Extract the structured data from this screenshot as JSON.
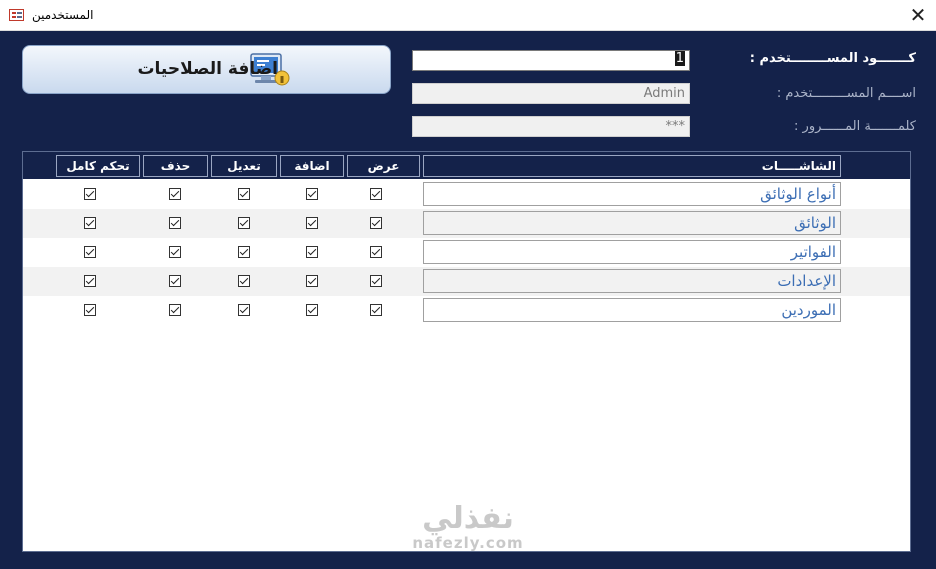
{
  "window": {
    "title": "المستخدمين",
    "close_glyph": "✕"
  },
  "form": {
    "permissions_button": "اضافة الصلاحيات",
    "user_code": {
      "label": "كـــــــود المســــــــتخدم :",
      "value": "1"
    },
    "user_name": {
      "label": "اســــم المســـــــــتخدم :",
      "value": "Admin"
    },
    "password": {
      "label": "كلمـــــــة المــــــرور :",
      "value": "***"
    }
  },
  "grid": {
    "headers": {
      "screens": "الشاشـــــات",
      "view": "عرض",
      "add": "اضافة",
      "edit": "تعديل",
      "delete": "حذف",
      "full_control": "تحكم كامل"
    },
    "rows": [
      {
        "screen": "أنواع الوثائق",
        "view": true,
        "add": true,
        "edit": true,
        "delete": true,
        "full_control": true
      },
      {
        "screen": "الوثائق",
        "view": true,
        "add": true,
        "edit": true,
        "delete": true,
        "full_control": true
      },
      {
        "screen": "الفواتير",
        "view": true,
        "add": true,
        "edit": true,
        "delete": true,
        "full_control": true
      },
      {
        "screen": "الإعدادات",
        "view": true,
        "add": true,
        "edit": true,
        "delete": true,
        "full_control": true
      },
      {
        "screen": "الموردين",
        "view": true,
        "add": true,
        "edit": true,
        "delete": true,
        "full_control": true
      }
    ]
  },
  "watermark": {
    "arabic": "نفذلي",
    "latin": "nafezly.com"
  },
  "colors": {
    "form_background": "#14224a",
    "screen_text": "#3c6eb4",
    "button_gradient_top": "#f3f7fc",
    "button_gradient_bottom": "#c9d9ee"
  }
}
